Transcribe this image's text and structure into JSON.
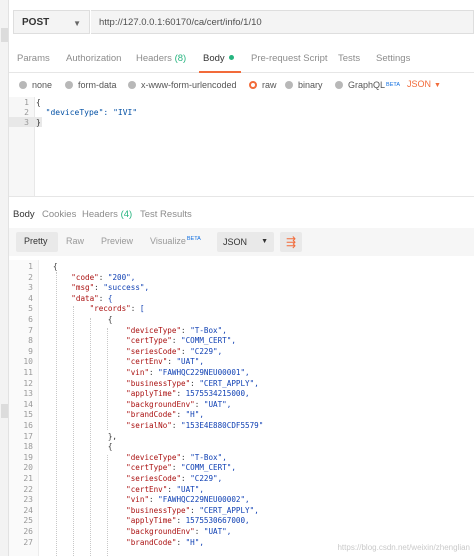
{
  "request": {
    "method": "POST",
    "url": "http://127.0.0.1:60170/ca/cert/info/1/10"
  },
  "request_tabs": [
    {
      "label": "Params"
    },
    {
      "label": "Authorization"
    },
    {
      "label": "Headers",
      "count": "(8)"
    },
    {
      "label": "Body",
      "active": true
    },
    {
      "label": "Pre-request Script"
    },
    {
      "label": "Tests"
    },
    {
      "label": "Settings"
    }
  ],
  "body_modes": {
    "none": "none",
    "form_data": "form-data",
    "urlencoded": "x-www-form-urlencoded",
    "raw": "raw",
    "binary": "binary",
    "graphql": "GraphQL",
    "graphql_badge": "BETA",
    "format": "JSON"
  },
  "request_body": {
    "line_numbers": [
      "1",
      "2",
      "3"
    ],
    "lines": [
      "{",
      "  \"deviceType\": \"IVI\"",
      "}"
    ]
  },
  "response_tabs": {
    "body": "Body",
    "cookies": "Cookies",
    "headers": "Headers",
    "headers_count": "(4)",
    "test_results": "Test Results"
  },
  "response_toolbar": {
    "pretty": "Pretty",
    "raw": "Raw",
    "preview": "Preview",
    "visualize": "Visualize",
    "visualize_badge": "BETA",
    "format": "JSON"
  },
  "response_body": {
    "line_numbers": [
      "1",
      "2",
      "3",
      "4",
      "5",
      "6",
      "7",
      "8",
      "9",
      "10",
      "11",
      "12",
      "13",
      "14",
      "15",
      "16",
      "17",
      "18",
      "19",
      "20",
      "21",
      "22",
      "23",
      "24",
      "25",
      "26",
      "27"
    ],
    "lines": [
      "{",
      "    \"code\": \"200\",",
      "    \"msg\": \"success\",",
      "    \"data\": {",
      "        \"records\": [",
      "            {",
      "                \"deviceType\": \"T-Box\",",
      "                \"certType\": \"COMM_CERT\",",
      "                \"seriesCode\": \"C229\",",
      "                \"certEnv\": \"UAT\",",
      "                \"vin\": \"FAWHQC229NEU00001\",",
      "                \"businessType\": \"CERT_APPLY\",",
      "                \"applyTime\": 1575534215000,",
      "                \"backgroundEnv\": \"UAT\",",
      "                \"brandCode\": \"H\",",
      "                \"serialNo\": \"153E4E880CDF5579\"",
      "            },",
      "            {",
      "                \"deviceType\": \"T-Box\",",
      "                \"certType\": \"COMM_CERT\",",
      "                \"seriesCode\": \"C229\",",
      "                \"certEnv\": \"UAT\",",
      "                \"vin\": \"FAWHQC229NEU00002\",",
      "                \"businessType\": \"CERT_APPLY\",",
      "                \"applyTime\": 1575530667000,",
      "                \"backgroundEnv\": \"UAT\",",
      "                \"brandCode\": \"H\","
    ]
  },
  "watermark": "https://blog.csdn.net/weixin/zhenglian",
  "colors": {
    "accent": "#f26b3a",
    "count_green": "#26b47f",
    "string_blue": "#0e3fb3",
    "key_red": "#a11111"
  }
}
